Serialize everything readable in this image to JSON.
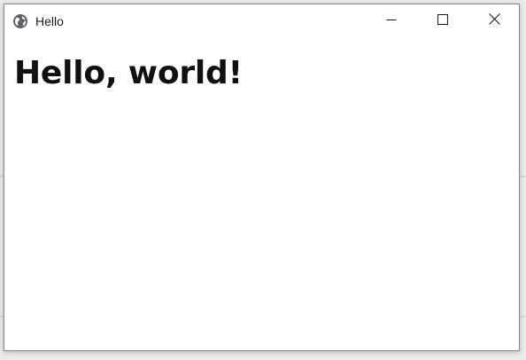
{
  "window": {
    "title": "Hello",
    "icon": "globe-icon",
    "controls": {
      "minimize": "minimize-icon",
      "maximize": "maximize-icon",
      "close": "close-icon"
    }
  },
  "content": {
    "heading": "Hello, world!"
  },
  "colors": {
    "window_bg": "#ffffff",
    "text": "#111111",
    "icon": "#5f6368"
  }
}
